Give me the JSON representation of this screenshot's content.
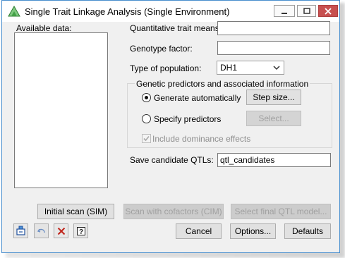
{
  "window": {
    "title": "Single Trait Linkage Analysis (Single Environment)"
  },
  "left_panel": {
    "available_data_label": "Available data:"
  },
  "form": {
    "quantitative_trait_means_label": "Quantitative trait means:",
    "quantitative_trait_means_value": "",
    "genotype_factor_label": "Genotype factor:",
    "genotype_factor_value": "",
    "type_of_population_label": "Type of population:",
    "type_of_population_value": "DH1"
  },
  "genetic_predictors": {
    "group_title": "Genetic predictors and associated information",
    "generate_automatically_label": "Generate automatically",
    "generate_automatically_selected": true,
    "step_size_button": "Step size...",
    "specify_predictors_label": "Specify predictors",
    "specify_predictors_selected": false,
    "select_button": "Select...",
    "include_dominance_label": "Include dominance effects",
    "include_dominance_checked": true
  },
  "save": {
    "label": "Save candidate QTLs:",
    "value": "qtl_candidates"
  },
  "action_buttons": {
    "initial_scan": "Initial scan (SIM)",
    "scan_with_cofactors": "Scan with cofactors (CIM)",
    "select_final_qtl": "Select final QTL model..."
  },
  "bottom_buttons": {
    "cancel": "Cancel",
    "options": "Options...",
    "defaults": "Defaults"
  },
  "icons": [
    "app-icon",
    "minimize-icon",
    "maximize-icon",
    "close-icon",
    "pin-icon",
    "undo-icon",
    "clear-icon",
    "help-icon",
    "chevron-down-icon"
  ],
  "colors": {
    "close_button": "#c75050",
    "window_border": "#4a8fce",
    "clear_icon": "#c0261c"
  }
}
